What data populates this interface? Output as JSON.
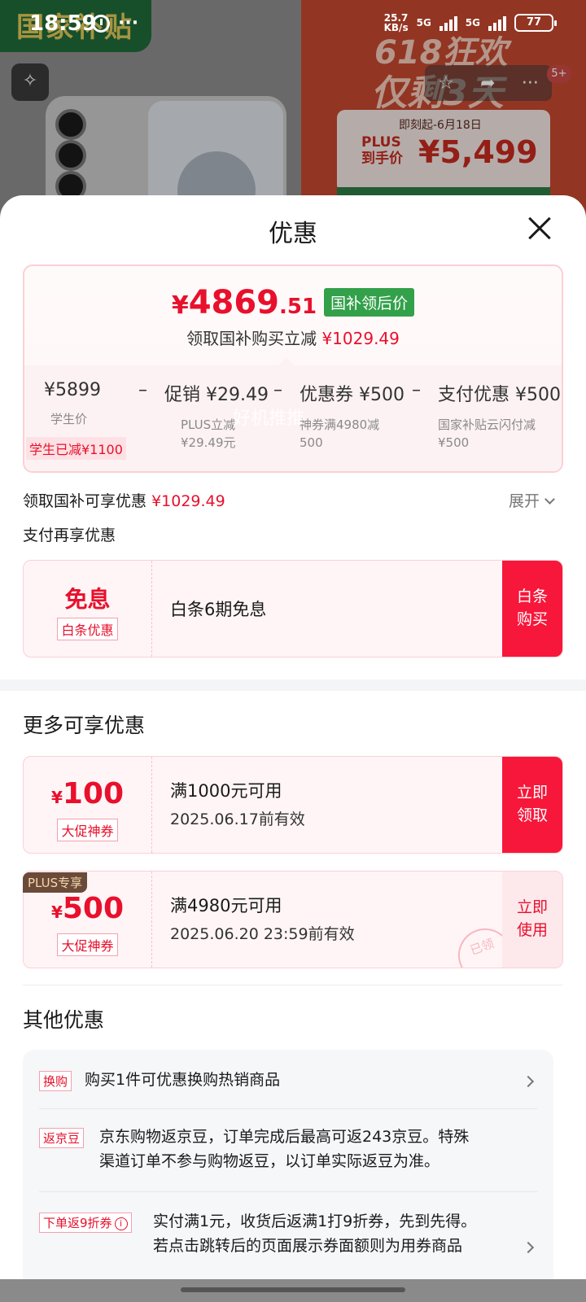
{
  "status_bar": {
    "time": "18:59",
    "net_speed": "25.7",
    "net_speed_unit": "KB/s",
    "signal1": "5G",
    "signal2": "5G",
    "battery": "77"
  },
  "background": {
    "left_badge": "国家补贴",
    "promo_line1": "618狂欢",
    "promo_line2": "仅剩3天",
    "price_card_date": "即刻起-6月18日",
    "price_card_plus": "PLUS",
    "price_card_label": "到手价",
    "price_card_value": "¥5,499",
    "notification_badge": "5+"
  },
  "sheet": {
    "title": "优惠"
  },
  "price_card": {
    "yen": "¥",
    "price_int": "4869",
    "price_dec": ".51",
    "tag": "国补领后价",
    "sub_text": "领取国补购买立减",
    "sub_amount": "¥1029.49",
    "calc": [
      {
        "value": "¥5899",
        "note": "学生价"
      },
      {
        "value": "促销 ¥29.49",
        "note": "PLUS立减\n¥29.49元"
      },
      {
        "value": "优惠券 ¥500",
        "note": "神券满4980减\n500"
      },
      {
        "value": "支付优惠 ¥500",
        "note": "国家补贴云闪付减\n¥500"
      }
    ],
    "minus": "–",
    "student_badge": "学生已减¥1100"
  },
  "subsidy_row": {
    "label": "领取国补可享优惠",
    "amount": "¥1029.49",
    "expand": "展开"
  },
  "pay_section": {
    "label": "支付再享优惠",
    "card": {
      "big": "免息",
      "tag": "白条优惠",
      "title": "白条6期免息",
      "button": "白条\n购买"
    }
  },
  "more_section": {
    "title": "更多可享优惠",
    "coupons": [
      {
        "yen": "¥",
        "amount": "100",
        "tag": "大促神券",
        "title": "满1000元可用",
        "sub": "2025.06.17前有效",
        "button": "立即\n领取"
      },
      {
        "yen": "¥",
        "amount": "500",
        "tag": "大促神券",
        "title": "满4980元可用",
        "sub": "2025.06.20 23:59前有效",
        "button": "立即\n使用",
        "badge": "PLUS专享",
        "stamp": "已领"
      }
    ]
  },
  "other_section": {
    "title": "其他优惠",
    "rows": [
      {
        "tag": "换购",
        "text": "购买1件可优惠换购热销商品"
      },
      {
        "tag": "返京豆",
        "text": "京东购物返京豆，订单完成后最高可返243京豆。特殊渠道订单不参与购物返豆，以订单实际返豆为准。",
        "line1": "京东购物返京豆，订单完成后最高可返243京豆。特殊",
        "line2": "渠道订单不参与购物返豆，以订单实际返豆为准。"
      },
      {
        "tag": "下单返9折券",
        "line1": "实付满1元，收货后返满1打9折券，先到先得。",
        "line2": "若点击跳转后的页面展示券面额则为用券商品"
      }
    ]
  },
  "watermark": "好机推推",
  "colors": {
    "accent": "#e8102c",
    "button_red": "#f7173a",
    "subsidy_green": "#33a04a"
  }
}
